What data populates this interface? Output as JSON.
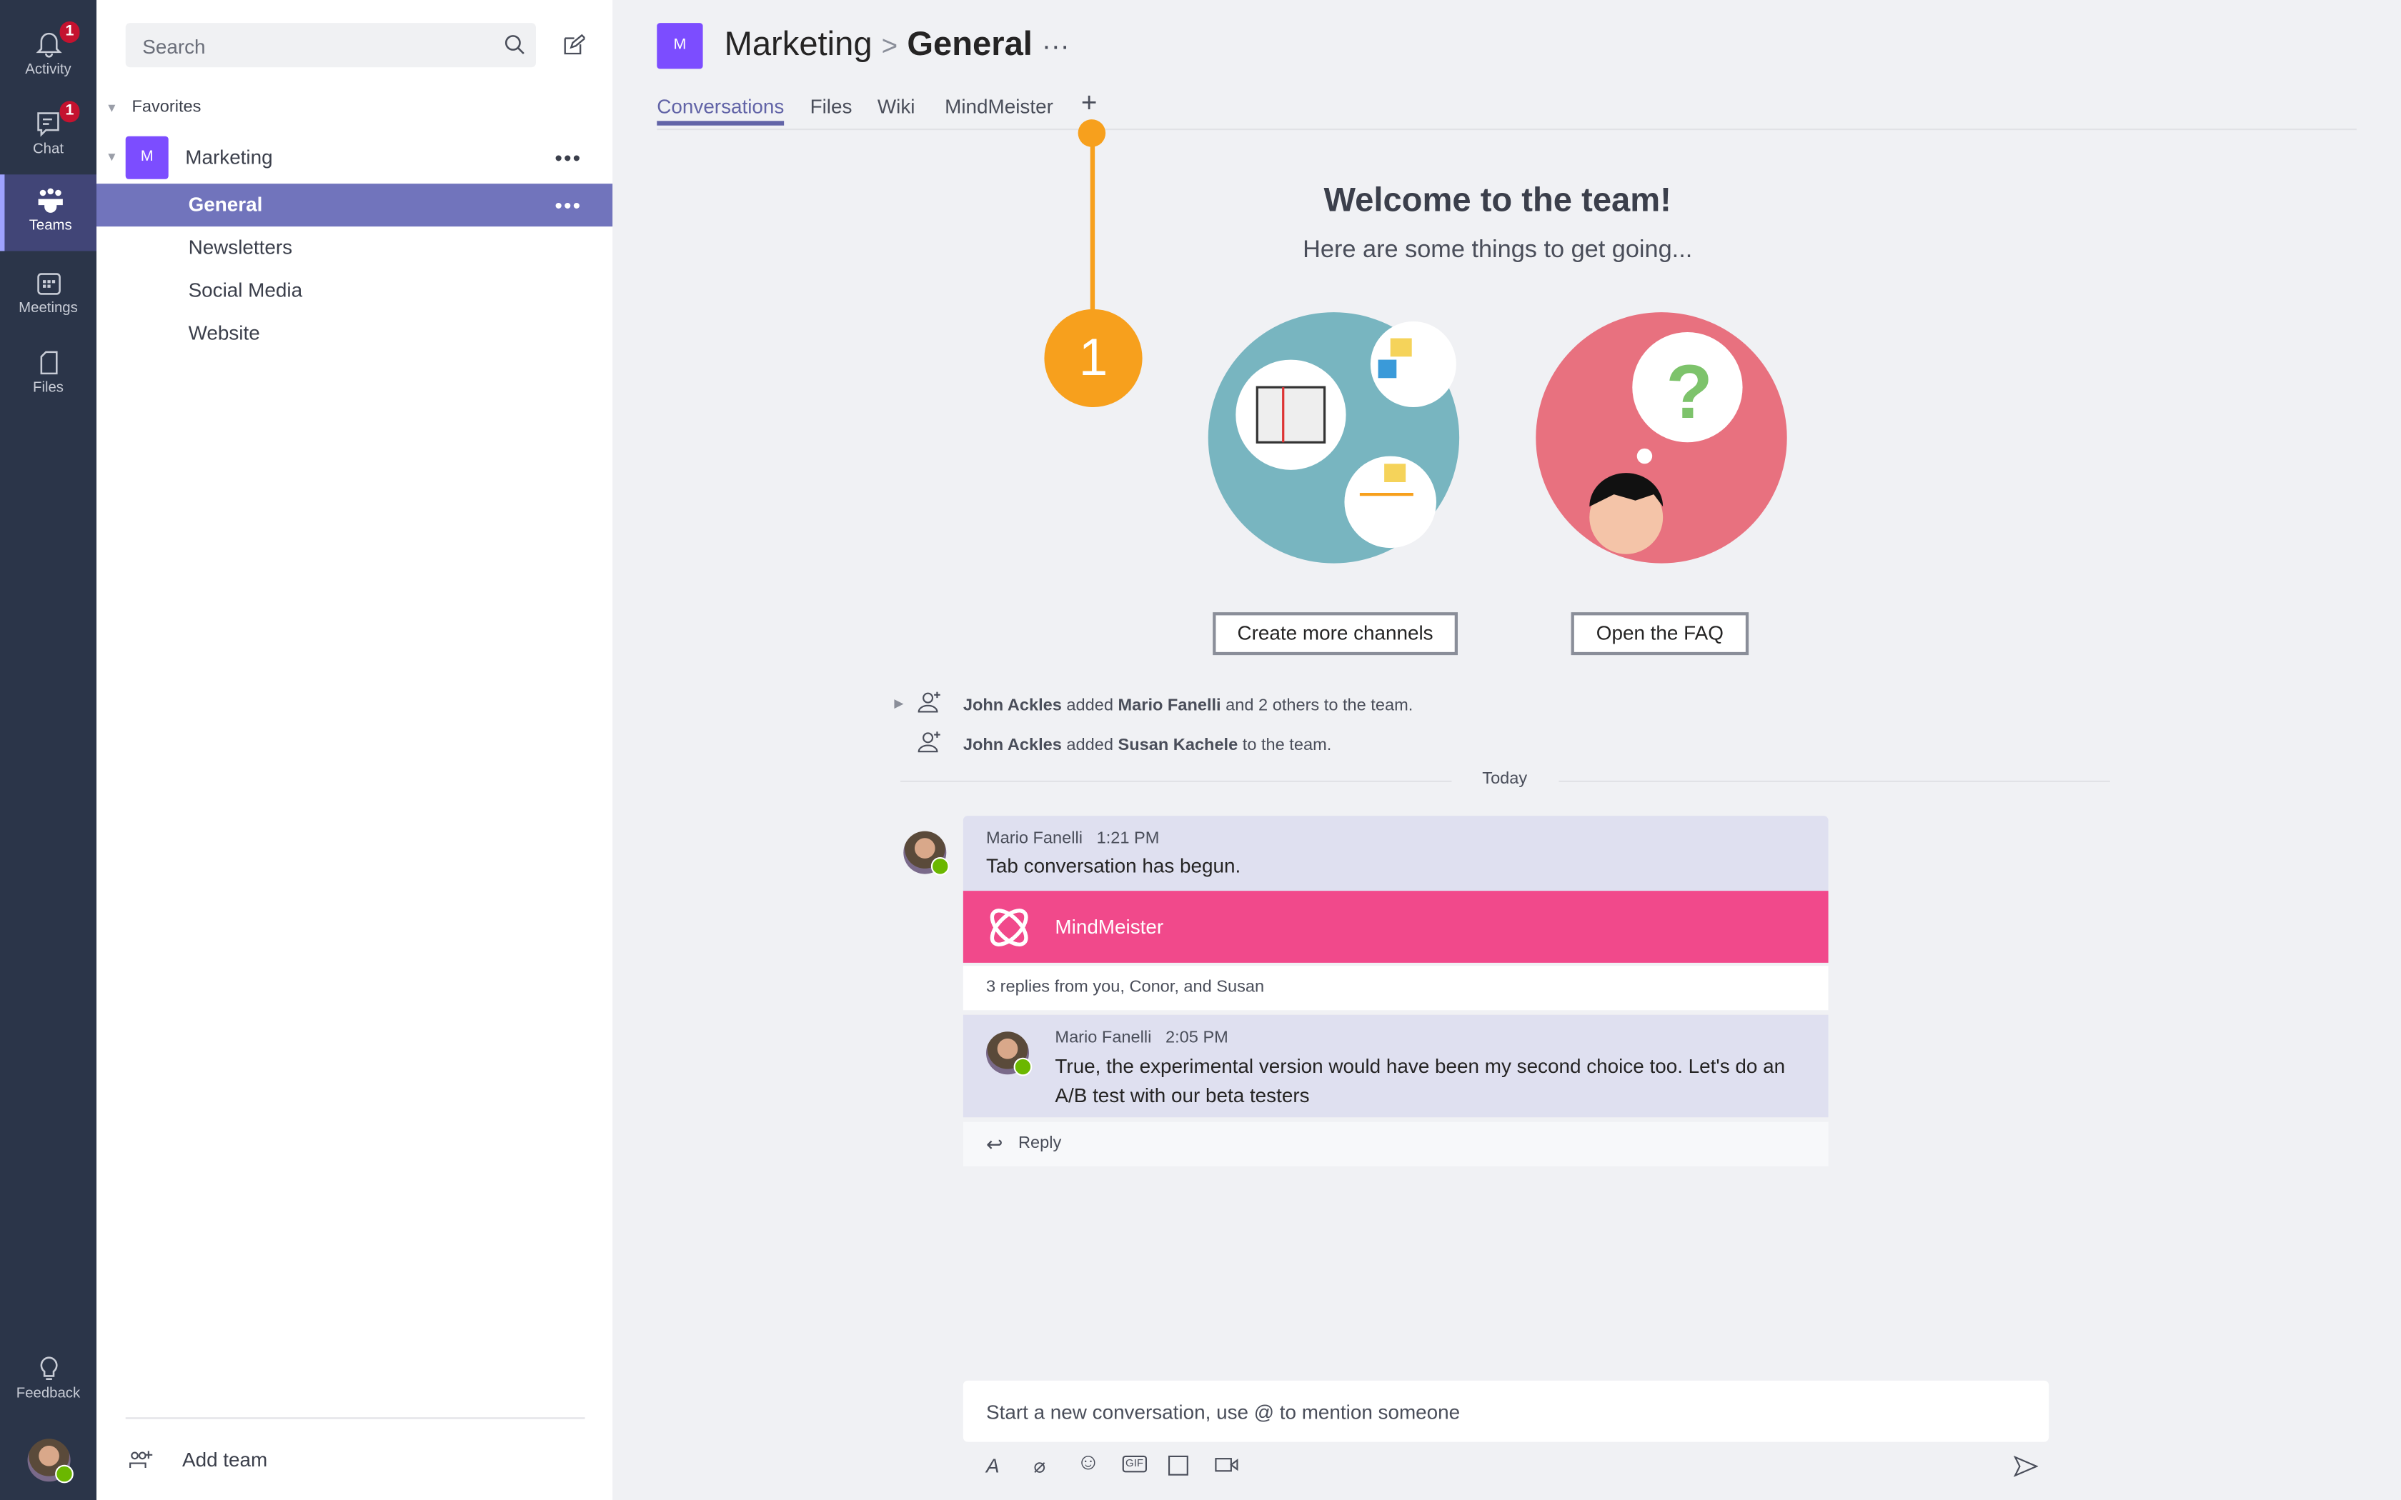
{
  "rail": {
    "items": [
      {
        "label": "Activity",
        "badge": "1"
      },
      {
        "label": "Chat",
        "badge": "1"
      },
      {
        "label": "Teams"
      },
      {
        "label": "Meetings"
      },
      {
        "label": "Files"
      }
    ],
    "feedback": "Feedback"
  },
  "panel": {
    "search_placeholder": "Search",
    "favorites": "Favorites",
    "team": {
      "initial": "M",
      "name": "Marketing"
    },
    "channels": [
      "General",
      "Newsletters",
      "Social Media",
      "Website"
    ],
    "add_team": "Add team",
    "more": "•••"
  },
  "header": {
    "initial": "M",
    "team": "Marketing",
    "sep": ">",
    "channel": "General",
    "more": "···"
  },
  "tabs": [
    "Conversations",
    "Files",
    "Wiki",
    "MindMeister"
  ],
  "callout": "1",
  "welcome": {
    "title": "Welcome to the team!",
    "subtitle": "Here are some things to get going...",
    "create_button": "Create more channels",
    "faq_button": "Open the FAQ"
  },
  "system": [
    {
      "actor": "John Ackles",
      "verb": " added ",
      "target": "Mario Fanelli",
      "rest": " and 2 others to the team."
    },
    {
      "actor": "John Ackles",
      "verb": " added ",
      "target": "Susan Kachele",
      "rest": " to the team."
    }
  ],
  "divider": "Today",
  "post": {
    "author": "Mario Fanelli",
    "time": "1:21 PM",
    "text": "Tab conversation has begun.",
    "app": "MindMeister",
    "replies": "3 replies from you, Conor, and Susan"
  },
  "reply": {
    "author": "Mario Fanelli",
    "time": "2:05 PM",
    "text": "True, the experimental version would have been my second choice too. Let's do an A/B test with our beta testers"
  },
  "reply_label": "Reply",
  "compose": {
    "placeholder": "Start a new conversation, use @ to mention someone"
  },
  "colors": {
    "rail": "#2b3549",
    "accent": "#7174bc",
    "mindmeister": "#f1498b",
    "callout": "#f7a01d"
  }
}
